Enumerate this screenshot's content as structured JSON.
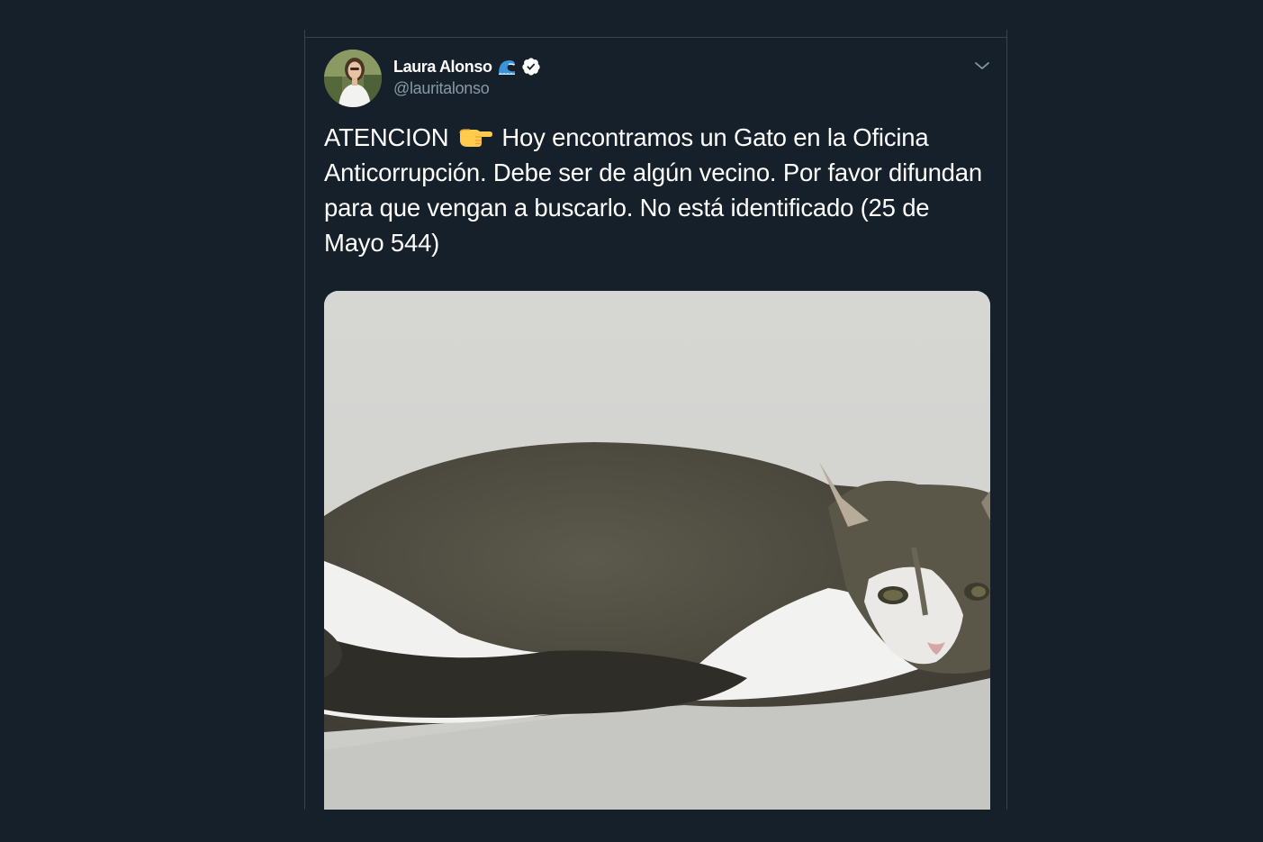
{
  "user": {
    "display_name": "Laura Alonso",
    "handle": "@lauritalonso"
  },
  "icons": {
    "name_emoji": "water-wave-icon",
    "verified": "verified-badge-icon",
    "menu": "chevron-down-icon",
    "text_emoji": "backhand-index-pointing-right-icon"
  },
  "tweet": {
    "text_part1": "ATENCION",
    "text_part2": "Hoy encontramos un Gato en la Oficina Anticorrupción. Debe ser de algún vecino. Por favor difundan para que vengan a buscarlo. No está identificado (25 de Mayo 544)"
  },
  "colors": {
    "background": "#15202b",
    "text": "#ffffff",
    "secondary_text": "#8899a6",
    "border": "#38444d"
  }
}
